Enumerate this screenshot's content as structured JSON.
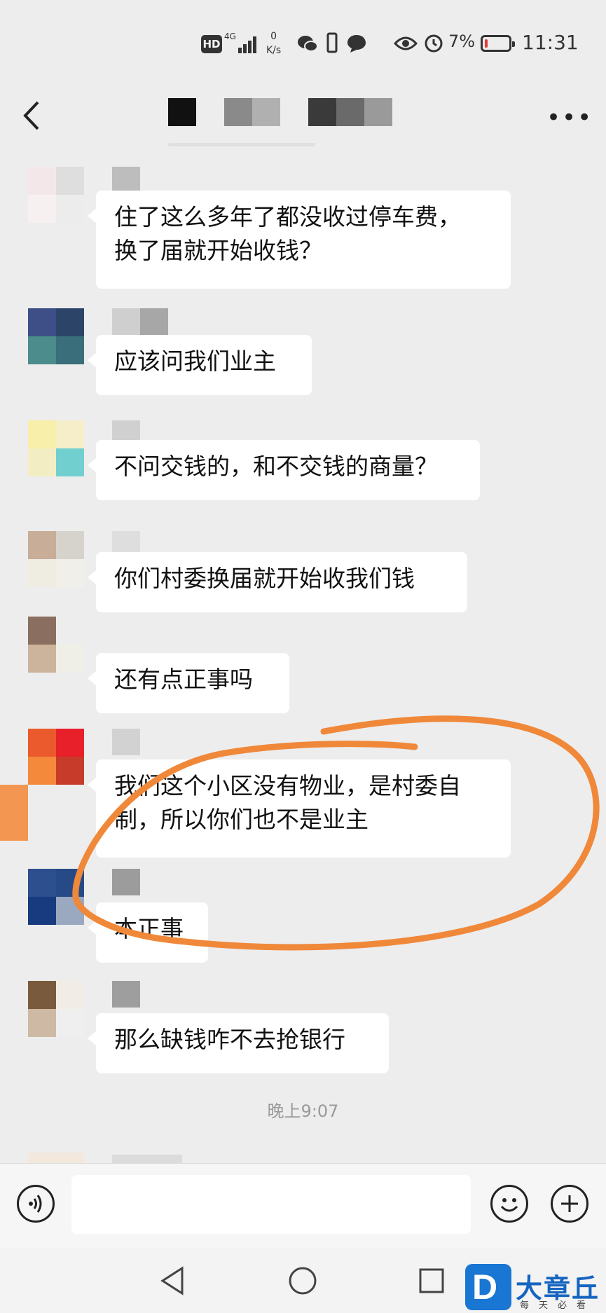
{
  "status_bar": {
    "hd": "HD",
    "network": "4G",
    "speed_value": "0",
    "speed_unit": "K/s",
    "battery_percent": "7%",
    "time": "11:31"
  },
  "messages": [
    {
      "text": "住了这么多年了都没收过停车费，\n换了届就开始收钱？"
    },
    {
      "text": "应该问我们业主"
    },
    {
      "text": "不问交钱的，和不交钱的商量？"
    },
    {
      "text": "你们村委换届就开始收我们钱"
    },
    {
      "text": "还有点正事吗"
    },
    {
      "text": "我们这个小区没有物业，是村委自\n制，所以你们也不是业主"
    },
    {
      "text": "本正事"
    },
    {
      "text": "那么缺钱咋不去抢银行"
    }
  ],
  "timestamp": "晚上9:07",
  "colors": {
    "annotation": "#f0883a",
    "background": "#ededed"
  },
  "watermark": {
    "name": "大章丘",
    "subtitle": "每天必看"
  }
}
